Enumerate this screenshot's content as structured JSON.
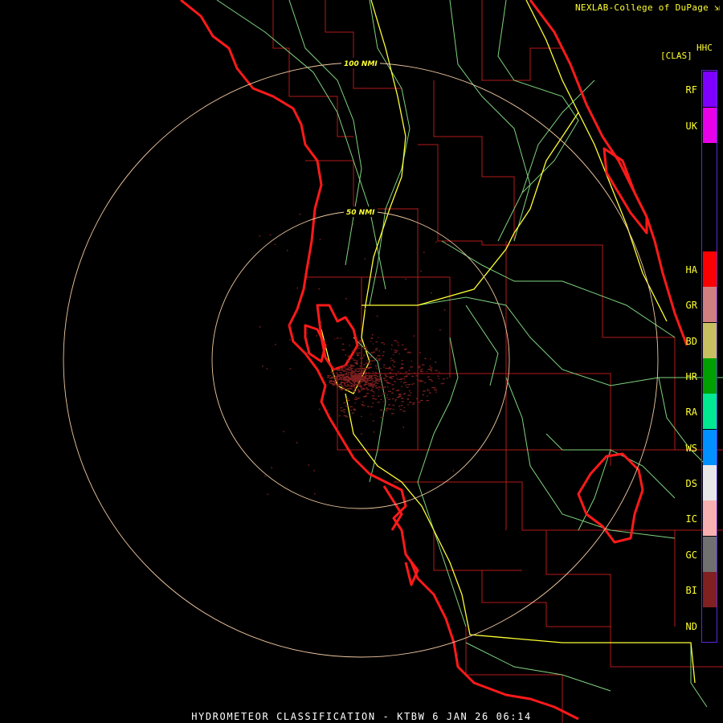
{
  "credit": "NEXLAB-College of DuPage",
  "credit_icon": "external-link-icon",
  "product_code": "HHC",
  "product_sub": "[CLAS]",
  "range_rings": [
    {
      "label": "100 NMI"
    },
    {
      "label": "50 NMI"
    }
  ],
  "legend": [
    {
      "code": "RF",
      "color": "#8000ff"
    },
    {
      "code": "UK",
      "color": "#e800e8"
    },
    {
      "code": "HA",
      "color": "#ff0000"
    },
    {
      "code": "GR",
      "color": "#d08080"
    },
    {
      "code": "BD",
      "color": "#c8c060"
    },
    {
      "code": "HR",
      "color": "#00a000"
    },
    {
      "code": "RA",
      "color": "#00e890"
    },
    {
      "code": "WS",
      "color": "#0090ff"
    },
    {
      "code": "DS",
      "color": "#e8e8e8"
    },
    {
      "code": "IC",
      "color": "#f8b0b0"
    },
    {
      "code": "GC",
      "color": "#707070"
    },
    {
      "code": "BI",
      "color": "#802020"
    },
    {
      "code": "ND",
      "color": "#000000"
    }
  ],
  "footer": "HYDROMETEOR CLASSIFICATION - KTBW 6 JAN 26 06:14",
  "colors": {
    "coast": "#ff1a1a",
    "county": "#b51a1a",
    "highway": "#ffff33",
    "road": "#7fd37f",
    "ring": "#f0c8a0",
    "echo": "#802020"
  }
}
